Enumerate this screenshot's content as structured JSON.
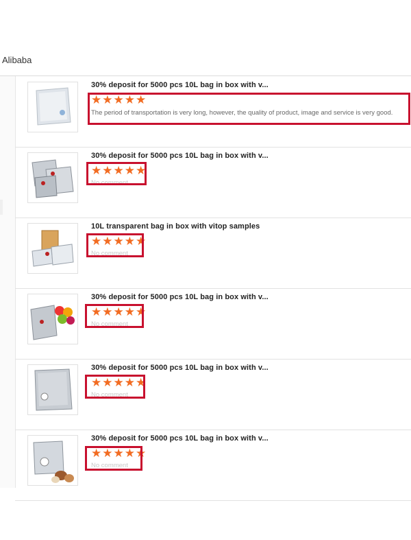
{
  "header": {
    "brand": "Alibaba"
  },
  "reviews": [
    {
      "title": "30% deposit for 5000 pcs 10L bag in box with v...",
      "stars": "★★★★★",
      "comment": "The period of transportation is very long, however, the quality of product, image and service is very good.",
      "comment_faded": false
    },
    {
      "title": "30% deposit for 5000 pcs 10L bag in box with v...",
      "stars": "★★★★★",
      "comment": "No comment",
      "comment_faded": true
    },
    {
      "title": "10L transparent bag in box with vitop samples",
      "stars": "★★★★★",
      "comment": "No comment",
      "comment_faded": true
    },
    {
      "title": "30% deposit for 5000 pcs 10L bag in box with v...",
      "stars": "★★★★★",
      "comment": "No comment",
      "comment_faded": true
    },
    {
      "title": "30% deposit for 5000 pcs 10L bag in box with v...",
      "stars": "★★★★★",
      "comment": "No comment",
      "comment_faded": true
    },
    {
      "title": "30% deposit for 5000 pcs 10L bag in box with v...",
      "stars": "★★★★★",
      "comment": "No comment",
      "comment_faded": true
    }
  ],
  "colors": {
    "star": "#f26c22",
    "highlight": "#c8102e"
  },
  "icons": {
    "product-image": "bag-in-box-photo"
  }
}
